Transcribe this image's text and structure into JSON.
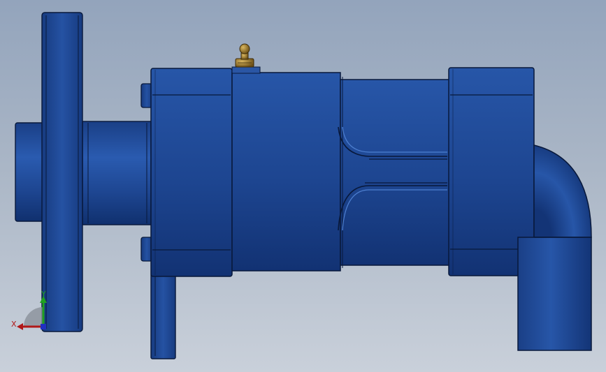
{
  "viewport": {
    "background_top": "#93a4bc",
    "background_bottom": "#c9d0da"
  },
  "model": {
    "body_color": "#1f4a98",
    "body_dark": "#0f2c66",
    "edge_color": "#08183a",
    "fitting_color": "#8a6a22"
  },
  "triad": {
    "x_label": "X",
    "y_label": "Y",
    "x_color": "#b01818",
    "y_color": "#20a020",
    "z_color": "#2030c0"
  }
}
